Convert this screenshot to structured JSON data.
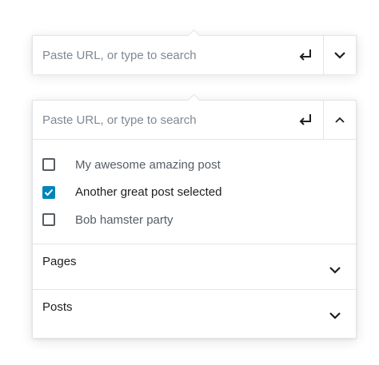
{
  "link_control_collapsed": {
    "placeholder": "Paste URL, or type to search",
    "submit_icon": "enter-arrow-icon",
    "toggle_icon": "chevron-down-icon",
    "expanded": false
  },
  "link_control_expanded": {
    "placeholder": "Paste URL, or type to search",
    "submit_icon": "enter-arrow-icon",
    "toggle_icon": "chevron-up-icon",
    "expanded": true,
    "results": [
      {
        "label": "My awesome amazing post",
        "checked": false
      },
      {
        "label": "Another great post selected",
        "checked": true
      },
      {
        "label": "Bob hamster party",
        "checked": false
      }
    ],
    "sections": [
      {
        "label": "Pages",
        "icon": "chevron-down-icon"
      },
      {
        "label": "Posts",
        "icon": "chevron-down-icon"
      }
    ]
  },
  "colors": {
    "accent": "#0085ba",
    "border": "#e2e4e7",
    "text": "#1e1e1e",
    "muted_text": "#555d66",
    "placeholder": "#7e8993"
  }
}
